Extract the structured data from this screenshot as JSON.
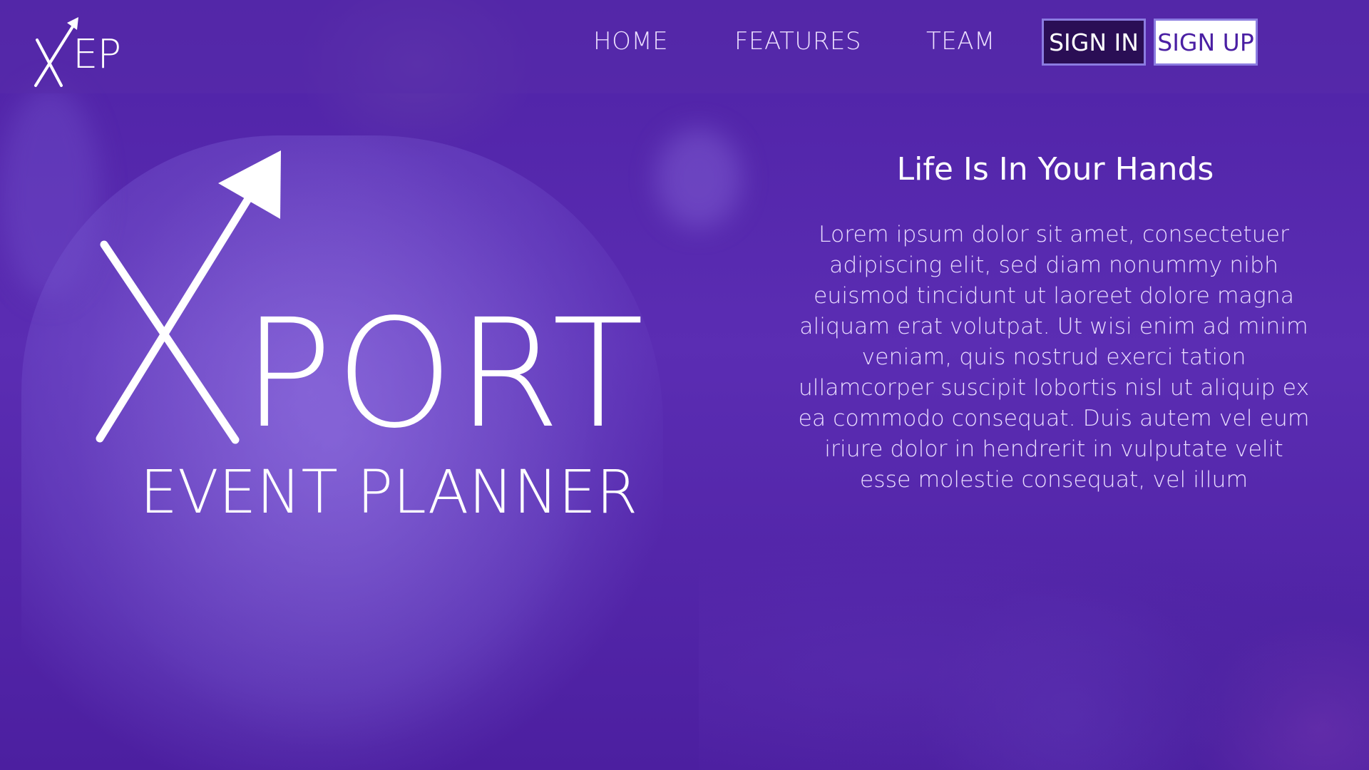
{
  "brand": {
    "logo_letters": "EP",
    "logo_x": "X"
  },
  "nav": {
    "links": [
      {
        "label": "HOME"
      },
      {
        "label": "FEATURES"
      },
      {
        "label": "TEAM"
      }
    ],
    "signin_label": "SIGN IN",
    "signup_label": "SIGN UP"
  },
  "hero": {
    "logo_word": "PORT",
    "logo_x": "X",
    "subtitle": "EVENT PLANNER",
    "tagline": "Life Is In Your Hands",
    "body": "Lorem ipsum dolor sit amet, consectetuer adipiscing elit, sed diam nonummy nibh euismod tincidunt ut laoreet dolore magna aliquam erat volutpat. Ut wisi enim ad minim veniam, quis nostrud exerci tation ullamcorper suscipit lobortis nisl ut aliquip ex ea commodo consequat. Duis autem vel eum iriure dolor in hendrerit in vulputate velit esse molestie consequat, vel illum"
  },
  "colors": {
    "background": "#5a2bb0",
    "signin_bg": "#2a0e55",
    "signup_bg": "#ffffff",
    "button_border": "#8b7ce0",
    "text": "#ffffff"
  },
  "icons": {
    "logo_arrow": "arrow-up-right-icon"
  }
}
